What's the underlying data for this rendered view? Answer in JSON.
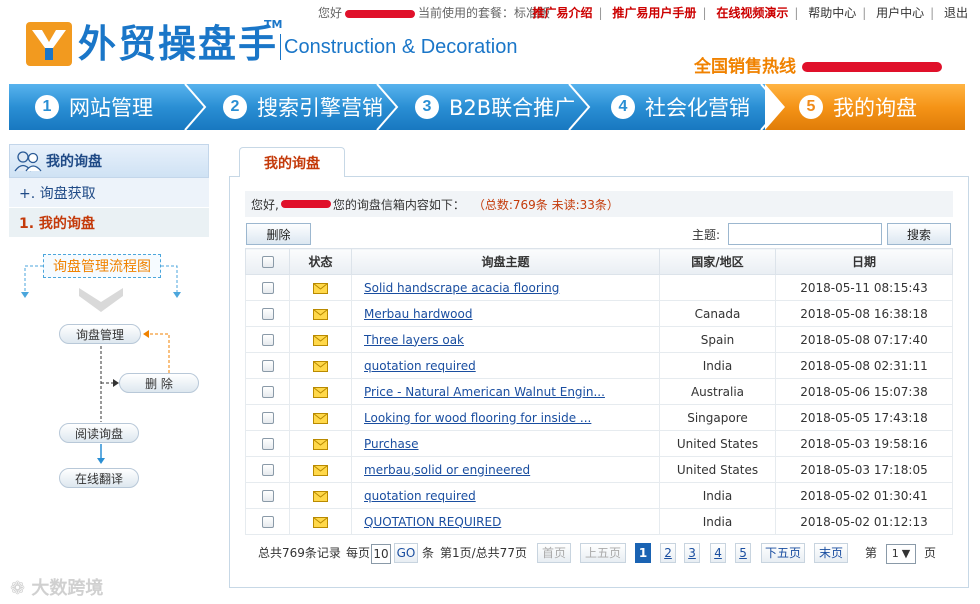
{
  "topbar": {
    "greeting_prefix": "您好",
    "package_text": "当前使用的套餐：标准版",
    "links": [
      {
        "label": "推广易介绍",
        "style": "red"
      },
      {
        "label": "推广易用户手册",
        "style": "red"
      },
      {
        "label": "在线视频演示",
        "style": "red"
      },
      {
        "label": "帮助中心",
        "style": "normal"
      },
      {
        "label": "用户中心",
        "style": "normal"
      },
      {
        "label": "退出",
        "style": "normal"
      }
    ]
  },
  "logo": {
    "cn": "外贸操盘手",
    "tm": "TM",
    "en": "Construction & Decoration"
  },
  "hotline": {
    "label": "全国销售热线"
  },
  "nav": [
    {
      "num": "1",
      "label": "网站管理"
    },
    {
      "num": "2",
      "label": "搜索引擎营销"
    },
    {
      "num": "3",
      "label": "B2B联合推广"
    },
    {
      "num": "4",
      "label": "社会化营销"
    },
    {
      "num": "5",
      "label": "我的询盘"
    }
  ],
  "sidebar": {
    "title": "我的询盘",
    "items": [
      {
        "label": "+. 询盘获取"
      },
      {
        "label": "1. 我的询盘"
      }
    ]
  },
  "flow": {
    "title": "询盘管理流程图",
    "manage": "询盘管理",
    "delete": "删  除",
    "read": "阅读询盘",
    "translate": "在线翻译"
  },
  "main": {
    "tab_label": "我的询盘",
    "greeting": "您好,",
    "info_text": "您的询盘信箱内容如下：",
    "counts": "（总数:769条   未读:33条）",
    "delete_button": "删除",
    "subject_label": "主题:",
    "subject_value": "",
    "search_button": "搜索",
    "columns": [
      "状态",
      "询盘主题",
      "国家/地区",
      "日期"
    ],
    "rows": [
      {
        "subject": "Solid handscrape acacia flooring",
        "country": "",
        "date": "2018-05-11 08:15:43"
      },
      {
        "subject": "Merbau hardwood",
        "country": "Canada",
        "date": "2018-05-08 16:38:18"
      },
      {
        "subject": "Three layers oak",
        "country": "Spain",
        "date": "2018-05-08 07:17:40"
      },
      {
        "subject": "quotation required",
        "country": "India",
        "date": "2018-05-08 02:31:11"
      },
      {
        "subject": "Price - Natural American Walnut Engin...",
        "country": "Australia",
        "date": "2018-05-06 15:07:38"
      },
      {
        "subject": "Looking for wood flooring for inside ...",
        "country": "Singapore",
        "date": "2018-05-05 17:43:18"
      },
      {
        "subject": "Purchase",
        "country": "United States",
        "date": "2018-05-03 19:58:16"
      },
      {
        "subject": "merbau,solid or engineered",
        "country": "United States",
        "date": "2018-05-03 17:18:05"
      },
      {
        "subject": "quotation required",
        "country": "India",
        "date": "2018-05-02 01:30:41"
      },
      {
        "subject": "QUOTATION REQUIRED",
        "country": "India",
        "date": "2018-05-02 01:12:13"
      }
    ]
  },
  "pager": {
    "total": "总共769条记录",
    "per_page_label": "每页",
    "per_page_value": "10",
    "go": "GO",
    "unit": "条",
    "page_info": "第1页/总共77页",
    "first": "首页",
    "prev5": "上五页",
    "pages": [
      "1",
      "2",
      "3",
      "4",
      "5"
    ],
    "next5": "下五页",
    "last": "末页",
    "jump_prefix": "第",
    "jump_value": "1",
    "jump_suffix": "页"
  },
  "watermark": "大数跨境",
  "colors": {
    "brand_blue": "#1a76c8",
    "nav_blue": "#2a8fd4",
    "nav_active_orange": "#f08a1a",
    "link_red": "#c00000",
    "hotline_orange": "#f08200"
  }
}
